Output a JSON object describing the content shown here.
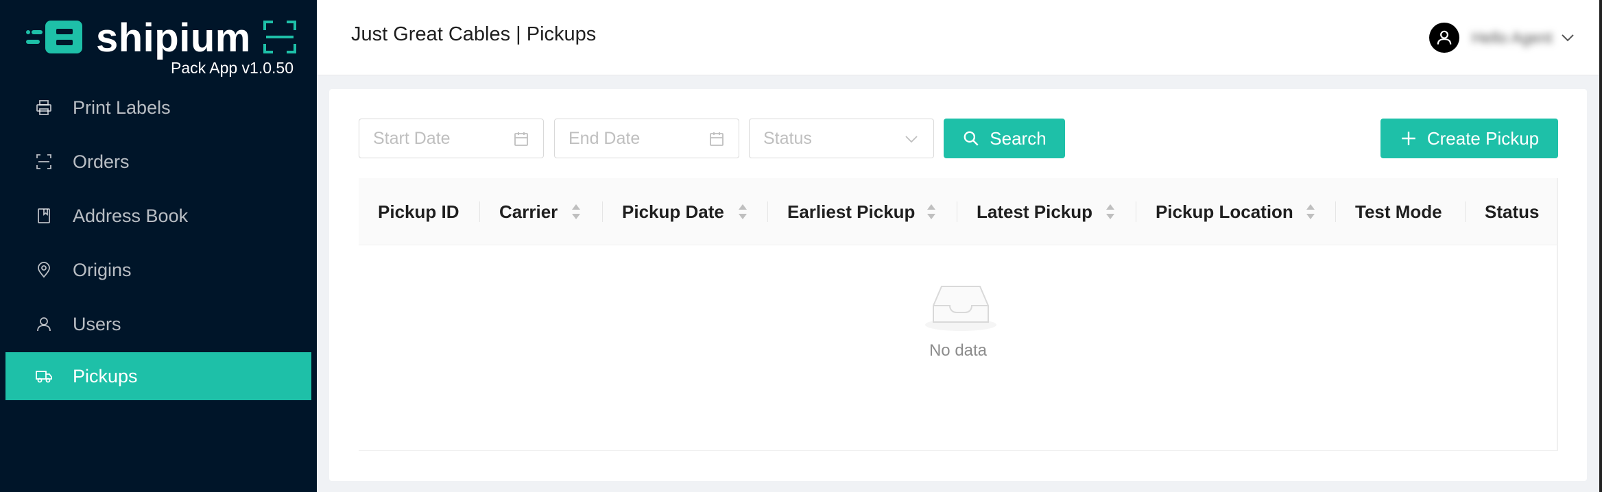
{
  "brand": {
    "name": "shipium",
    "version": "Pack App v1.0.50",
    "accent_color": "#1ec0a8",
    "sidebar_color": "#001529"
  },
  "sidebar": {
    "items": [
      {
        "label": "Print Labels",
        "icon": "printer-icon",
        "active": false
      },
      {
        "label": "Orders",
        "icon": "scan-icon",
        "active": false
      },
      {
        "label": "Address Book",
        "icon": "book-icon",
        "active": false
      },
      {
        "label": "Origins",
        "icon": "location-pin-icon",
        "active": false
      },
      {
        "label": "Users",
        "icon": "user-icon",
        "active": false
      },
      {
        "label": "Pickups",
        "icon": "truck-icon",
        "active": true
      }
    ]
  },
  "header": {
    "title": "Just Great Cables | Pickups",
    "user_name": "Hello Agent"
  },
  "filters": {
    "start_date_placeholder": "Start Date",
    "end_date_placeholder": "End Date",
    "status_placeholder": "Status",
    "search_label": "Search",
    "create_label": "Create Pickup"
  },
  "table": {
    "columns": [
      {
        "label": "Pickup ID",
        "sortable": false
      },
      {
        "label": "Carrier",
        "sortable": true
      },
      {
        "label": "Pickup Date",
        "sortable": true
      },
      {
        "label": "Earliest Pickup",
        "sortable": true
      },
      {
        "label": "Latest Pickup",
        "sortable": true
      },
      {
        "label": "Pickup Location",
        "sortable": true
      },
      {
        "label": "Test Mode",
        "sortable": false
      },
      {
        "label": "Status",
        "sortable": false
      }
    ],
    "rows": [],
    "empty_text": "No data"
  }
}
